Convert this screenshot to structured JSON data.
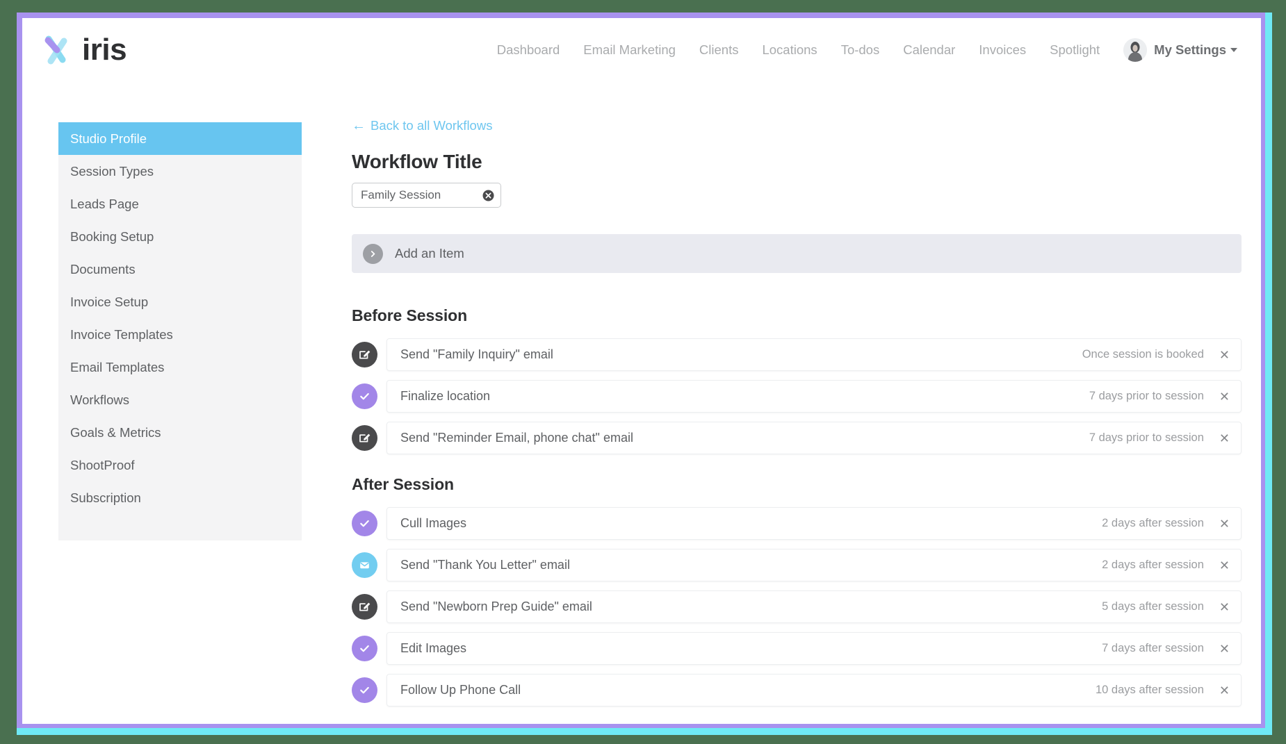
{
  "brand": {
    "name": "iris",
    "logo_colors": {
      "purple": "#a892ef",
      "cyan": "#7fd8f0"
    }
  },
  "topnav": {
    "links": [
      {
        "label": "Dashboard"
      },
      {
        "label": "Email Marketing"
      },
      {
        "label": "Clients"
      },
      {
        "label": "Locations"
      },
      {
        "label": "To-dos"
      },
      {
        "label": "Calendar"
      },
      {
        "label": "Invoices"
      },
      {
        "label": "Spotlight"
      }
    ],
    "my_settings_label": "My Settings",
    "avatar_alt": "user-avatar"
  },
  "sidebar": {
    "active_index": 0,
    "items": [
      {
        "label": "Studio Profile"
      },
      {
        "label": "Session Types"
      },
      {
        "label": "Leads Page"
      },
      {
        "label": "Booking Setup"
      },
      {
        "label": "Documents"
      },
      {
        "label": "Invoice Setup"
      },
      {
        "label": "Invoice Templates"
      },
      {
        "label": "Email Templates"
      },
      {
        "label": "Workflows"
      },
      {
        "label": "Goals & Metrics"
      },
      {
        "label": "ShootProof"
      },
      {
        "label": "Subscription"
      }
    ]
  },
  "main": {
    "back_link": "Back to all Workflows",
    "title_heading": "Workflow Title",
    "title_input_value": "Family Session",
    "title_input_placeholder": "Workflow title",
    "add_item_label": "Add an Item",
    "sections": [
      {
        "heading": "Before Session",
        "rows": [
          {
            "label": "Send \"Family Inquiry\" email",
            "timing": "Once session is booked",
            "icon": "edit-icon",
            "icon_color": "#4a4a4c"
          },
          {
            "label": "Finalize location",
            "timing": "7 days prior to session",
            "icon": "check-icon",
            "icon_color": "#a286e8"
          },
          {
            "label": "Send \"Reminder Email, phone chat\" email",
            "timing": "7 days prior to session",
            "icon": "edit-icon",
            "icon_color": "#4a4a4c"
          }
        ]
      },
      {
        "heading": "After Session",
        "rows": [
          {
            "label": "Cull Images",
            "timing": "2 days after session",
            "icon": "check-icon",
            "icon_color": "#a286e8"
          },
          {
            "label": "Send \"Thank You Letter\" email",
            "timing": "2 days after session",
            "icon": "envelope-icon",
            "icon_color": "#72cdf0"
          },
          {
            "label": "Send \"Newborn Prep Guide\" email",
            "timing": "5 days after session",
            "icon": "edit-icon",
            "icon_color": "#4a4a4c"
          },
          {
            "label": "Edit Images",
            "timing": "7 days after session",
            "icon": "check-icon",
            "icon_color": "#a286e8"
          },
          {
            "label": "Follow Up Phone Call",
            "timing": "10 days after session",
            "icon": "check-icon",
            "icon_color": "#a286e8"
          }
        ]
      }
    ],
    "remove_glyph": "✕"
  },
  "chrome": {
    "outer_bg": "#4a7050",
    "rim_purple": "#a892ef",
    "rim_cyan": "#6fe9f5",
    "accent_blue": "#67c5f0"
  }
}
